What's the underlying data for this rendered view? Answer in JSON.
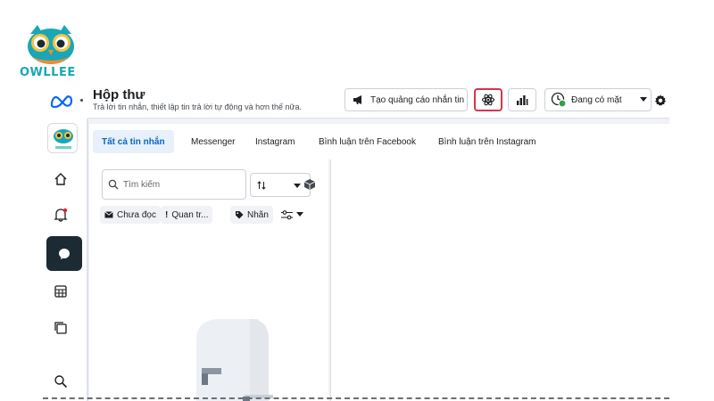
{
  "watermark": {
    "text": "OWLLEE"
  },
  "header": {
    "title": "Hộp thư",
    "subtitle": "Trả lời tin nhắn, thiết lập tin trả lời tự động và hơn thế nữa.",
    "ad_button_label": "Tạo quảng cáo nhắn tin",
    "status_label": "Đang có mặt"
  },
  "tabs": [
    {
      "label": "Tất cả tin nhắn",
      "active": true
    },
    {
      "label": "Messenger"
    },
    {
      "label": "Instagram"
    },
    {
      "label": "Bình luận trên Facebook"
    },
    {
      "label": "Bình luận trên Instagram"
    }
  ],
  "search": {
    "placeholder": "Tìm kiếm"
  },
  "filters": [
    {
      "label": "Chưa đọc",
      "icon": "envelope-icon"
    },
    {
      "label": "Quan tr...",
      "icon": "exclamation-icon"
    },
    {
      "label": "Nhãn",
      "icon": "tag-icon"
    }
  ],
  "rail": {
    "items": [
      {
        "icon": "home-icon"
      },
      {
        "icon": "bell-icon",
        "has_badge": true
      },
      {
        "icon": "chat-icon",
        "active": true
      },
      {
        "icon": "table-icon"
      },
      {
        "icon": "pages-icon"
      },
      {
        "icon": "search-icon"
      }
    ]
  },
  "colors": {
    "accent": "#0a66c2",
    "highlight_border": "#d6334f",
    "rail_active_bg": "#1c2b33",
    "status_online": "#31a24c",
    "notification_badge": "#e41e3f"
  }
}
